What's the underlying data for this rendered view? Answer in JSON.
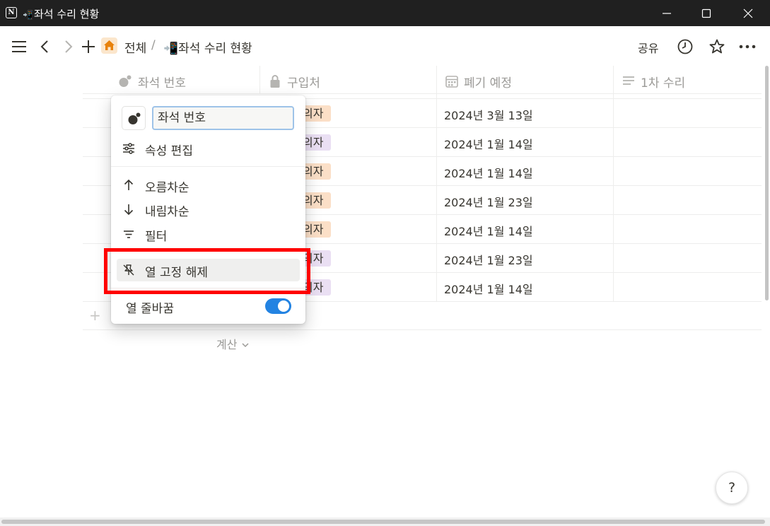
{
  "window": {
    "title_emoji": "📲",
    "title": "좌석 수리 현황",
    "app_icon_letter": "N"
  },
  "topbar": {
    "breadcrumb_root": "전체",
    "breadcrumb_separator": "/",
    "breadcrumb_page": "📲좌석 수리 현황",
    "share_label": "공유"
  },
  "table": {
    "columns": [
      {
        "label": "좌석 번호",
        "icon": "title-dots-icon"
      },
      {
        "label": "구입처",
        "icon": "lock-icon"
      },
      {
        "label": "폐기 예정",
        "icon": "calendar-icon"
      },
      {
        "label": "1차 수리",
        "icon": "text-lines-icon"
      }
    ],
    "rows": [
      {
        "tag": "의자",
        "tag_color": "#fbdfc7",
        "date": "2024년 3월 13일"
      },
      {
        "tag": "의자",
        "tag_color": "#eadff3",
        "date": "2024년 1월 14일"
      },
      {
        "tag": "의자",
        "tag_color": "#fbdfc7",
        "date": "2024년 1월 14일"
      },
      {
        "tag": "의자",
        "tag_color": "#fbdfc7",
        "date": "2024년 1월 23일"
      },
      {
        "tag": "의자",
        "tag_color": "#fbdfc7",
        "date": "2024년 1월 14일"
      },
      {
        "tag": "의자",
        "tag_color": "#eadff3",
        "date": "2024년 1월 23일"
      },
      {
        "tag": "의자",
        "tag_color": "#eadff3",
        "date": "2024년 1월 14일"
      }
    ],
    "add_row_symbol": "+",
    "calc_label": "계산"
  },
  "popup": {
    "name_value": "좌석 번호",
    "edit_property": "속성 편집",
    "sort_asc": "오름차순",
    "sort_desc": "내림차순",
    "filter": "필터",
    "unfreeze": "열 고정 해제",
    "wrap_column": "열 줄바꿈",
    "wrap_enabled": true
  },
  "help_label": "?",
  "colors": {
    "accent": "#2383e2",
    "highlight": "#ff0000",
    "home_icon": "#e8820c"
  }
}
